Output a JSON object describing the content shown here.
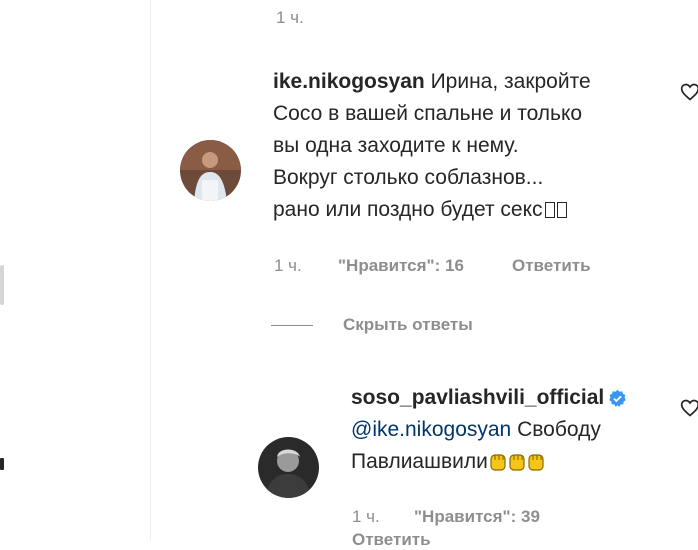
{
  "top_comment": {
    "time": "1 ч."
  },
  "comment1": {
    "username": "ike.nikogosyan",
    "text_line1": "Ирина, закройте",
    "text_line2": "Сосо в вашей спальне и только",
    "text_line3": "вы одна заходите к нему.",
    "text_line4": "Вокруг столько соблазнов...",
    "text_line5": "рано или поздно будет секс",
    "time": "1 ч.",
    "likes": "\"Нравится\": 16",
    "reply_label": "Ответить"
  },
  "replies_toggle": {
    "label": "Скрыть ответы"
  },
  "reply1": {
    "username": "soso_pavliashvili_official",
    "mention": "@ike.nikogosyan",
    "text_line1": " Свободу",
    "text_line2": "Павлиашвили",
    "time": "1 ч.",
    "likes": "\"Нравится\": 39",
    "reply_label": "Ответить"
  },
  "colors": {
    "muted": "#8e8e8e",
    "text": "#262626",
    "mention": "#00376b",
    "verified": "#3897f0"
  },
  "icons": {
    "like": "heart-icon",
    "verified": "verified-badge-icon",
    "emoji": "raised-fist-emoji"
  }
}
